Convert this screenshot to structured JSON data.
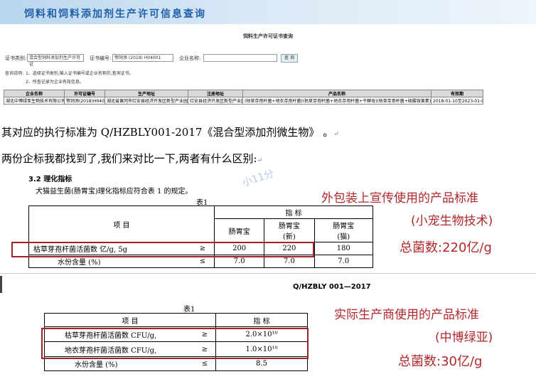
{
  "site": {
    "banner_title": "饲料和饲料添加剂生产许可信息查询",
    "page_heading": "饲料生产许可证书查询"
  },
  "form": {
    "cert_type_label": "证书类别:",
    "cert_type_value": "混合型饲料添加剂生产许可证",
    "cert_no_label": "证书编号:",
    "cert_no_value": "鄂饲添 (2018) H04001",
    "company_label": "企业名称:",
    "company_value": "",
    "query_button": "查 询"
  },
  "hints": {
    "title": "查询说明:",
    "line1": "1、选择证书类别,输入证书编号或企业名称的,查询证书。",
    "line2": "2、所查记录为企业有效信息。"
  },
  "result_table": {
    "headers": [
      "企业名称",
      "许可证编号",
      "生产地址",
      "注册地址",
      "产品名称",
      "有效期"
    ],
    "row": [
      "湖北中博绿亚生物技术有限公司",
      "鄂饲添(2018)H04001",
      "湖北省黄冈市红安县经济开发区新型产业园瓦金大道",
      "红安县经济开发区新型产业园",
      "(枯草芽孢杆菌+地衣芽孢杆菌)(枯草芽孢杆菌+地衣芽孢杆菌+干酵母)(枯草芽孢杆菌+硫酸铵黄素)",
      "2018-01-10至2023-01-09"
    ]
  },
  "text": {
    "line1": "其对应的执行标准为 Q/HZBLY001-2017《混合型添加剂微生物》 。",
    "line2": "两份企标我都找到了,我们来对比一下,两者有什么区别:",
    "return_mark": "↵"
  },
  "doc1": {
    "section": "3.2  理化指标",
    "intro": "犬猫益生菌(肠胃宝)理化指标应符合表 1 的规定。",
    "table_caption": "表1",
    "watermark": "小11分",
    "col_item": "项          目",
    "col_index": "指          标",
    "sub_headers": [
      "肠胃宝",
      "肠胃宝\n(新)",
      "肠胃宝\n(猫)"
    ],
    "rows": [
      {
        "item": "枯草芽孢杆菌活菌数 亿/g, 5g",
        "op": "≥",
        "values": [
          "200",
          "220",
          "180"
        ]
      },
      {
        "item": "水份含量 (%)",
        "op": "≤",
        "values": [
          "7.0",
          "7.0",
          "7.0"
        ]
      }
    ],
    "callout1": "外包装上宣传使用的产品标准",
    "callout2": "(小宠生物技术)",
    "callout3": "总菌数:220亿/g"
  },
  "doc2": {
    "code": "Q/HZBLY 001—2017",
    "table_caption": "表1",
    "col_item": "项          目",
    "col_index": "指          标",
    "rows": [
      {
        "item": "枯草芽孢杆菌活菌数 CFU/g,",
        "op": "≥",
        "value": "2.0×10¹⁰"
      },
      {
        "item": "地衣芽孢杆菌活菌数 CFU/g,",
        "op": "≥",
        "value": "1.0×10¹⁰"
      },
      {
        "item": "水份含量 (%)",
        "op": "≤",
        "value": "8.5"
      }
    ],
    "callout1": "实际生产商使用的产品标准",
    "callout2": "(中博绿亚)",
    "callout3": "总菌数:30亿/g"
  },
  "colors": {
    "accent_red": "#a0222a",
    "callout_red": "#b0282c",
    "banner_blue": "#1f5fa8"
  }
}
